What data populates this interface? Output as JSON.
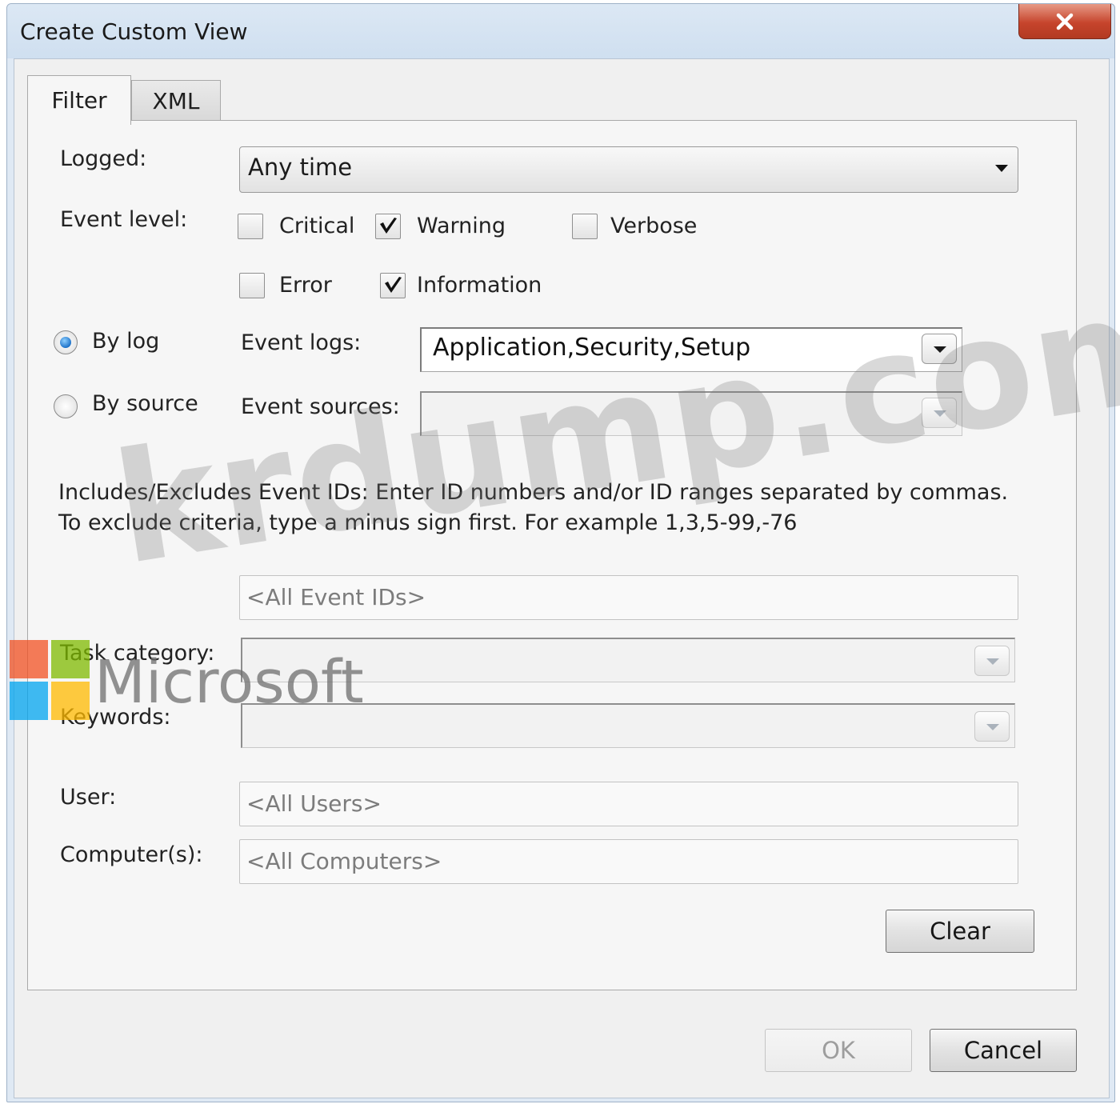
{
  "window": {
    "title": "Create Custom View",
    "close_icon": "close-icon"
  },
  "tabs": [
    {
      "label": "Filter",
      "active": true
    },
    {
      "label": "XML",
      "active": false
    }
  ],
  "filter": {
    "logged": {
      "label": "Logged:",
      "value": "Any time"
    },
    "event_level": {
      "label": "Event level:",
      "options": [
        {
          "label": "Critical",
          "checked": false
        },
        {
          "label": "Warning",
          "checked": true
        },
        {
          "label": "Verbose",
          "checked": false
        },
        {
          "label": "Error",
          "checked": false
        },
        {
          "label": "Information",
          "checked": true
        }
      ]
    },
    "by_log": {
      "label": "By log",
      "selected": true
    },
    "by_source": {
      "label": "By source",
      "selected": false
    },
    "event_logs": {
      "label": "Event logs:",
      "value": "Application,Security,Setup"
    },
    "event_sources": {
      "label": "Event sources:",
      "value": ""
    },
    "description": "Includes/Excludes Event IDs: Enter ID numbers and/or ID ranges separated by commas. To exclude criteria, type a minus sign first. For example 1,3,5-99,-76",
    "event_ids": {
      "placeholder": "<All Event IDs>"
    },
    "task_category": {
      "label": "Task category:",
      "value": ""
    },
    "keywords": {
      "label": "Keywords:",
      "value": ""
    },
    "user": {
      "label": "User:",
      "placeholder": "<All Users>"
    },
    "computers": {
      "label": "Computer(s):",
      "placeholder": "<All Computers>"
    },
    "clear_label": "Clear"
  },
  "footer": {
    "ok_label": "OK",
    "cancel_label": "Cancel"
  },
  "watermark": {
    "text": "krdump.com",
    "logo_text": "Microsoft"
  },
  "colors": {
    "radio_selected": "#1f73c9",
    "close_button": "#c6442c"
  }
}
